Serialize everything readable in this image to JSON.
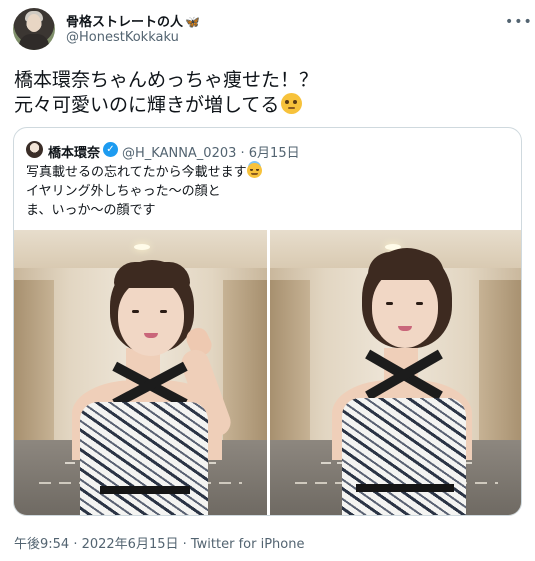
{
  "author": {
    "name": "骨格ストレートの人",
    "name_emoji": "🦋",
    "handle": "@HonestKokkaku"
  },
  "more_icon": "more-dots-icon",
  "tweet": {
    "line1": "橋本環奈ちゃんめっちゃ痩せた！？",
    "line2": "元々可愛いのに輝きが増してる"
  },
  "quoted_tweet": {
    "name": "橋本環奈",
    "verified": true,
    "meta": "@H_KANNA_0203 · 6月15日",
    "line1": "写真載せるの忘れてたから今載せます",
    "line2": "イヤリング外しちゃった〜の顔と",
    "line3": "ま、いっか〜の顔です",
    "photos": [
      "hallway-photo-left",
      "hallway-photo-right"
    ]
  },
  "footer": {
    "meta": "午後9:54 · 2022年6月15日 · Twitter for iPhone"
  },
  "colors": {
    "text": "#0f1419",
    "secondary": "#536471",
    "border": "#cfd9de",
    "verified": "#1d9bf0"
  }
}
